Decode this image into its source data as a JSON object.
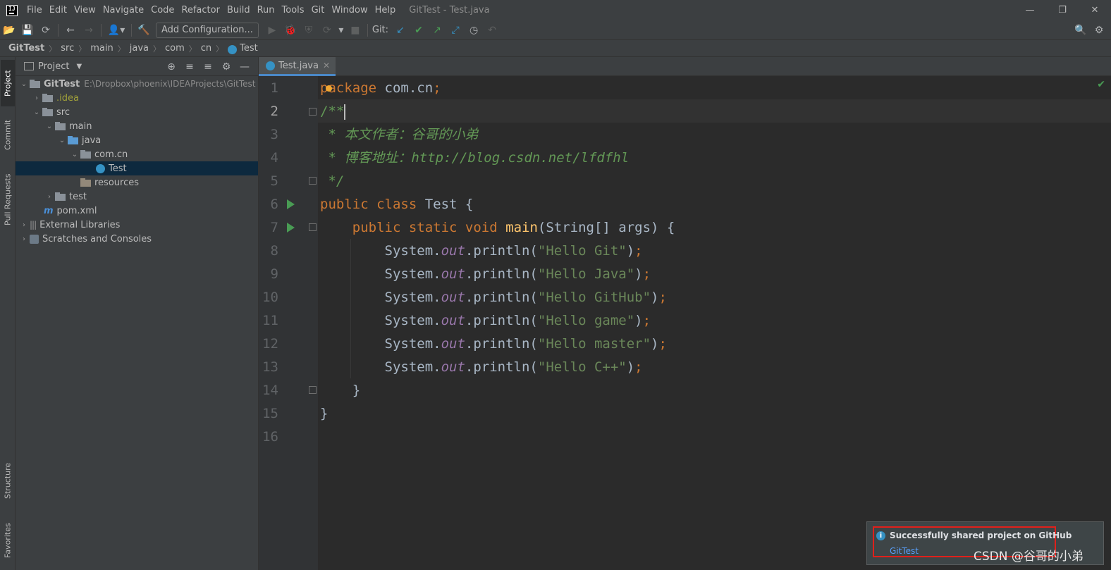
{
  "menubar": {
    "logo": "IJ",
    "items": [
      "File",
      "Edit",
      "View",
      "Navigate",
      "Code",
      "Refactor",
      "Build",
      "Run",
      "Tools",
      "Git",
      "Window",
      "Help"
    ],
    "window_title": "GitTest - Test.java",
    "minimize": "—",
    "restore": "❐",
    "close": "✕"
  },
  "toolbar": {
    "open": "📂",
    "save": "💾",
    "sync": "⟳",
    "back": "←",
    "forward": "→",
    "user": "👤▾",
    "build": "🔨",
    "add_configuration": "Add Configuration...",
    "run": "▶",
    "debug": "🐞",
    "coverage": "⛨",
    "profile": "⟳",
    "more": "▾",
    "stop": "■",
    "git_label": "Git:",
    "update": "↙",
    "commit": "✔",
    "push": "↗",
    "merge": "⤢",
    "history": "◷",
    "rollback": "↶",
    "search": "🔍",
    "settings": "⚙"
  },
  "breadcrumb": {
    "items": [
      "GitTest",
      "src",
      "main",
      "java",
      "com",
      "cn",
      "Test"
    ],
    "separator": "〉"
  },
  "left_stripe": {
    "project": "Project",
    "commit": "Commit",
    "pull_requests": "Pull Requests",
    "structure": "Structure",
    "favorites": "Favorites"
  },
  "project_panel": {
    "title": "Project",
    "caret": "▼",
    "tools": [
      "⊕",
      "≡",
      "≡",
      "⚙",
      "—"
    ],
    "tree": [
      {
        "label": "GitTest",
        "path": "E:\\Dropbox\\phoenix\\IDEAProjects\\GitTest"
      },
      {
        "label": ".idea"
      },
      {
        "label": "src"
      },
      {
        "label": "main"
      },
      {
        "label": "java"
      },
      {
        "label": "com.cn"
      },
      {
        "label": "Test"
      },
      {
        "label": "resources"
      },
      {
        "label": "test"
      },
      {
        "label": "pom.xml"
      },
      {
        "label": "External Libraries"
      },
      {
        "label": "Scratches and Consoles"
      }
    ],
    "arrow_down": "⌄",
    "arrow_right": "›",
    "maven_glyph": "m",
    "lib_glyph": "|||"
  },
  "editor": {
    "tab_label": "Test.java",
    "tab_close": "✕",
    "check": "✔",
    "line_numbers": [
      "1",
      "2",
      "3",
      "4",
      "5",
      "6",
      "7",
      "8",
      "9",
      "10",
      "11",
      "12",
      "13",
      "14",
      "15",
      "16"
    ],
    "code": {
      "l1_kw": "package",
      "l1_rest": " com.cn",
      "l1_semi": ";",
      "l2": "/**",
      "l3": " * 本文作者：谷哥的小弟",
      "l4": " * 博客地址：http://blog.csdn.net/lfdfhl",
      "l5": " */",
      "l6_kw": "public class",
      "l6_rest": " Test {",
      "l7_indent": "    ",
      "l7_kw": "public static void",
      "l7_space": " ",
      "l7_fn": "main",
      "l7_rest": "(String[] args) {",
      "print_prefix": "        System.",
      "print_field": "out",
      "print_call": ".println(",
      "print_close": ")",
      "print_semi": ";",
      "strings": [
        "\"Hello Git\"",
        "\"Hello Java\"",
        "\"Hello GitHub\"",
        "\"Hello game\"",
        "\"Hello master\"",
        "\"Hello C++\""
      ],
      "l14": "    }",
      "l15": "}"
    }
  },
  "notification": {
    "icon": "i",
    "title": "Successfully shared project on GitHub",
    "link": "GitTest"
  },
  "watermark": "CSDN @谷哥的小弟"
}
